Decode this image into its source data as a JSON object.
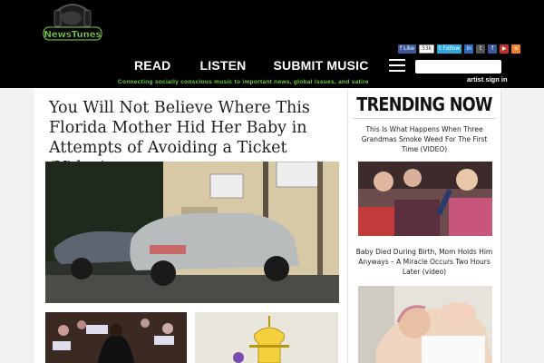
{
  "header": {
    "logo_text": "NewsTunes",
    "social": {
      "like_label": "Like",
      "like_count": "33k",
      "follow_label": "Follow"
    },
    "nav": [
      {
        "label": "READ"
      },
      {
        "label": "LISTEN"
      },
      {
        "label": "SUBMIT MUSIC"
      }
    ],
    "tagline": "Connecting socially conscious music to important news, global issues, and satire",
    "search": {
      "value": "",
      "placeholder": ""
    },
    "signin_label": "artist sign in"
  },
  "article": {
    "title": "You Will Not Believe Where This Florida Mother Hid Her Baby in Attempts of Avoiding a Ticket (Video)"
  },
  "trending": {
    "heading": "TRENDING NOW",
    "items": [
      {
        "headline": "This Is What Happens When Three Grandmas Smoke Weed For The First Time (VIDEO)"
      },
      {
        "headline": "Baby Died During Birth, Mom Holds Him Anyways – A Miracle Occurs Two Hours Later (video)"
      }
    ]
  },
  "colors": {
    "header_bg": "#000000",
    "tagline": "#6bd142",
    "facebook": "#3b5998",
    "twitter": "#2ea8e0"
  }
}
